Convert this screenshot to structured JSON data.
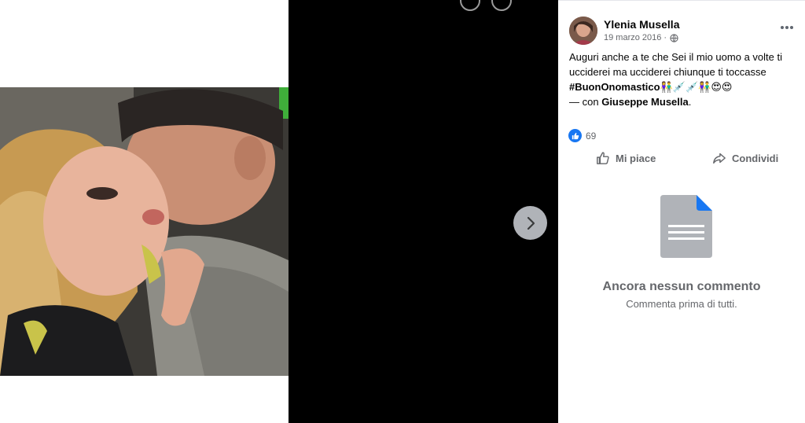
{
  "post": {
    "author": "Ylenia Musella",
    "date": "19 marzo 2016 ·",
    "privacy_icon": "globe-icon",
    "text": "Auguri anche a te che Sei il mio uomo a volte ti ucciderei ma ucciderei chiunque ti toccasse",
    "hashtag": "#BuonOnomastico",
    "emojis": "👫💉💉👫😍😍",
    "with_prefix": "— con",
    "with_name": "Giuseppe Musella",
    "with_suffix": "."
  },
  "reactions": {
    "icon": "like-icon",
    "count": "69"
  },
  "actions": {
    "like_label": "Mi piace",
    "share_label": "Condividi"
  },
  "comments": {
    "empty_title": "Ancora nessun commento",
    "empty_subtitle": "Commenta prima di tutti."
  },
  "viewer": {
    "next_icon": "chevron-right-icon"
  },
  "colors": {
    "accent": "#1877f2",
    "muted": "#65676b",
    "viewer_bg": "#000000"
  }
}
